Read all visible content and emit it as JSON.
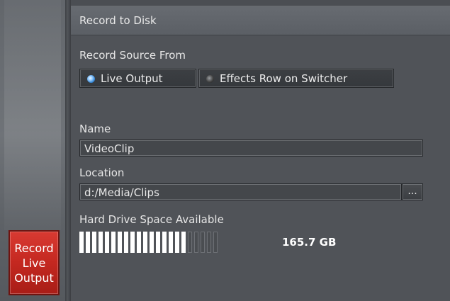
{
  "sidebar": {
    "record_button": [
      "Record",
      "Live",
      "Output"
    ]
  },
  "panel": {
    "title": "Record to Disk",
    "source": {
      "label": "Record Source From",
      "options": [
        {
          "label": "Live Output",
          "selected": true
        },
        {
          "label": "Effects Row on Switcher",
          "selected": false
        }
      ]
    },
    "name": {
      "label": "Name",
      "value": "VideoClip"
    },
    "location": {
      "label": "Location",
      "value": "d:/Media/Clips",
      "browse_label": "..."
    },
    "disk": {
      "label": "Hard Drive Space Available",
      "value": "165.7 GB",
      "segments_total": 22,
      "segments_filled": 17
    }
  },
  "colors": {
    "record_button": "#c42820",
    "radio_selected": "#2d7fd0",
    "background": "#505358"
  }
}
